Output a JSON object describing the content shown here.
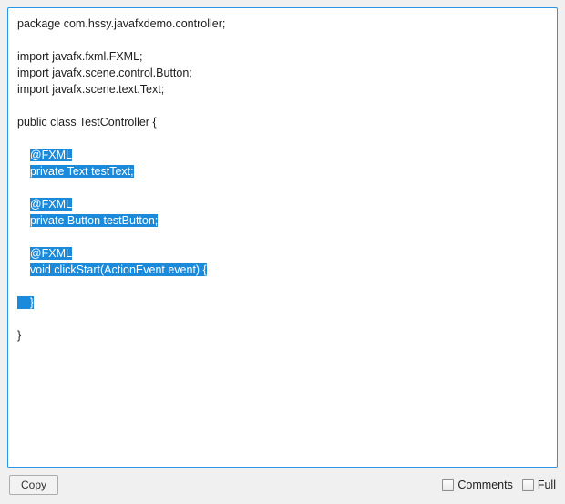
{
  "code": {
    "l1": "package com.hssy.javafxdemo.controller;",
    "blank": "",
    "l3": "import javafx.fxml.FXML;",
    "l4": "import javafx.scene.control.Button;",
    "l5": "import javafx.scene.text.Text;",
    "l7": "public class TestController {",
    "ind1": "    ",
    "s1a": "@FXML",
    "s1b": "private Text testText;",
    "s2a": "@FXML",
    "s2b": "private Button testButton;",
    "s3a": "@FXML",
    "s3b": "void clickStart(ActionEvent event) {",
    "s4pad": "    ",
    "s4": "}",
    "l_end": "}"
  },
  "footer": {
    "copy_label": "Copy",
    "comments_label": "Comments",
    "full_label": "Full"
  }
}
